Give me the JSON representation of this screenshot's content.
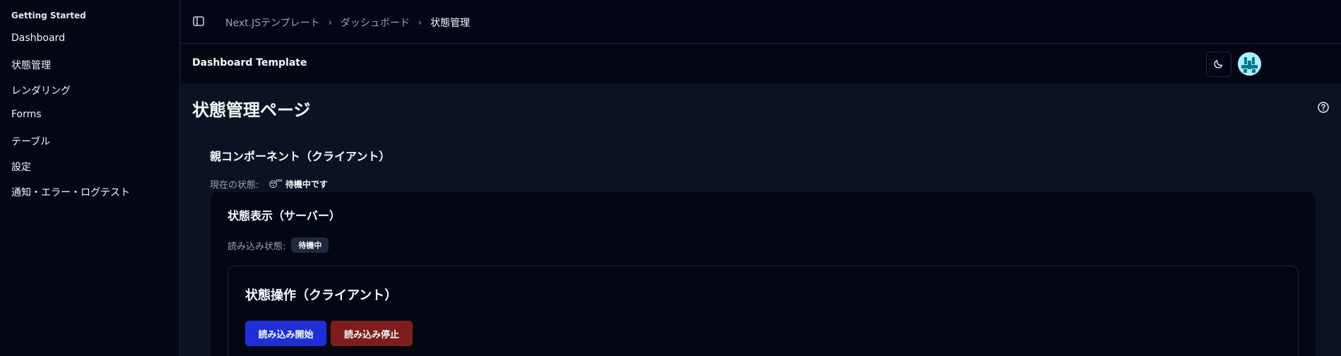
{
  "sidebar": {
    "group_label": "Getting Started",
    "items": [
      {
        "label": "Dashboard"
      },
      {
        "label": "状態管理"
      },
      {
        "label": "レンダリング"
      },
      {
        "label": "Forms"
      },
      {
        "label": "テーブル"
      },
      {
        "label": "設定"
      },
      {
        "label": "通知・エラー・ログテスト"
      }
    ]
  },
  "breadcrumb": {
    "items": [
      "Next.JSテンプレート",
      "ダッシュボード",
      "状態管理"
    ],
    "separator": "›"
  },
  "header": {
    "app_title": "Dashboard Template",
    "theme_icon": "moon-icon"
  },
  "main": {
    "page_title": "状態管理ページ",
    "help_icon": "help-circle-icon",
    "parent": {
      "title": "親コンポーネント（クライアント）",
      "status_label": "現在の状態:",
      "status_emoji": "😴",
      "status_value": "待機中です"
    },
    "server": {
      "title": "状態表示（サーバー）",
      "load_label": "読み込み状態:",
      "load_badge": "待機中"
    },
    "client": {
      "title": "状態操作（クライアント）",
      "start_label": "読み込み開始",
      "stop_label": "読み込み停止"
    }
  },
  "colors": {
    "start_button": "#1d2fd8",
    "stop_button": "#7f1d1d",
    "background": "#020817"
  }
}
